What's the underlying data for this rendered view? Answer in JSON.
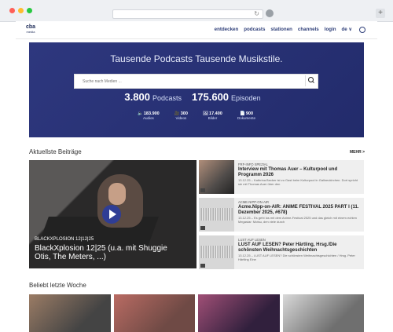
{
  "browser": {
    "reload_symbol": "↻"
  },
  "site": {
    "logo_line1": "cba",
    "logo_line2": "media",
    "nav": [
      "entdecken",
      "podcasts",
      "stationen",
      "channels",
      "login",
      "de ∨"
    ],
    "hero_title": "Tausende Podcasts Tausende Musikstile.",
    "search_placeholder": "Suche nach Medien ...",
    "stats": {
      "podcasts_count": "3.800",
      "podcasts_label": "Podcasts",
      "episodes_count": "175.600",
      "episodes_label": "Episoden",
      "audios_value": "183.900",
      "audios_label": "Audios",
      "videos_value": "300",
      "videos_label": "Videos",
      "images_value": "17.400",
      "images_label": "Bilder",
      "documents_value": "900",
      "documents_label": "Dokumente"
    },
    "latest_title": "Aktuellste Beiträge",
    "more_label": "MEHR >",
    "featured": {
      "channel": "BLACKXPLOSION 12|12|25",
      "title": "BlackXplosion 12|25 (u.a. mit Shuggie Otis, The Meters, ...)"
    },
    "items": [
      {
        "meta": "FRF-INFO SPEZIAL",
        "title": "Interview mit Thomas Auer – Kulturpool und Programm 2026",
        "desc": "13.12.25 – Kathrina Becker ist zu Gast beim Kulturpool in Gallneukirchen. Dort spricht sie mit Thomas Auer über den"
      },
      {
        "meta": "ACME.NIPP-ON-AIR",
        "title": "Acme.Nipp-on-AIR: ANIME FESTIVAL 2025 PART I (11. Dezember 2025, #678)",
        "desc": "13.12.25 – Es geht los mit dem Anime-Festival 2025 und das gleich mit einem echten Megastar: Motsu, den viele durch"
      },
      {
        "meta": "LUST AUF LESEN",
        "title": "LUST AUF LESEN? Peter Härtling, Hrsg./Die schönsten Weihnachtsgeschichten",
        "desc": "13.12.25 – LUST AUF LESEN? Die schönsten Weihnachtsgeschichten / Hrsg. Peter Härtling Eine"
      }
    ],
    "popular_title": "Beliebt letzte Woche"
  }
}
